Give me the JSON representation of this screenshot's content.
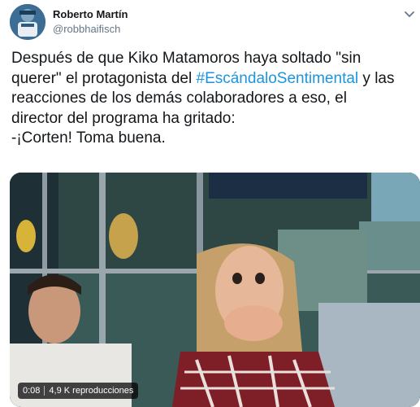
{
  "tweet": {
    "author_name": "Roberto Martín",
    "author_handle": "@robbhaifisch",
    "text_lines": [
      [
        "Después de que Kiko Matamoros haya soltado \"sin",
        ""
      ],
      [
        "querer\" el protagonista del ",
        "#EscándaloSentimental",
        " y las"
      ],
      [
        "reacciones de los demás colaboradores a eso, el"
      ],
      [
        "director del programa ha gritado:"
      ],
      [
        "-¡Corten! Toma buena."
      ]
    ],
    "line1": "Después de que Kiko Matamoros haya soltado \"sin",
    "line2_a": "querer\" el protagonista del ",
    "line2_hashtag": "#EscándaloSentimental",
    "line2_b": " y las",
    "line3": "reacciones de los demás colaboradores a eso, el",
    "line4": "director del programa ha gritado:",
    "line5": "-¡Corten! Toma buena."
  },
  "video": {
    "duration": "0:08",
    "views": "4,9 K reproducciones"
  },
  "colors": {
    "hashtag": "#1b95e0",
    "handle": "#657786",
    "text": "#14171a"
  },
  "icons": [
    "avatar-image",
    "chevron-down-icon"
  ]
}
